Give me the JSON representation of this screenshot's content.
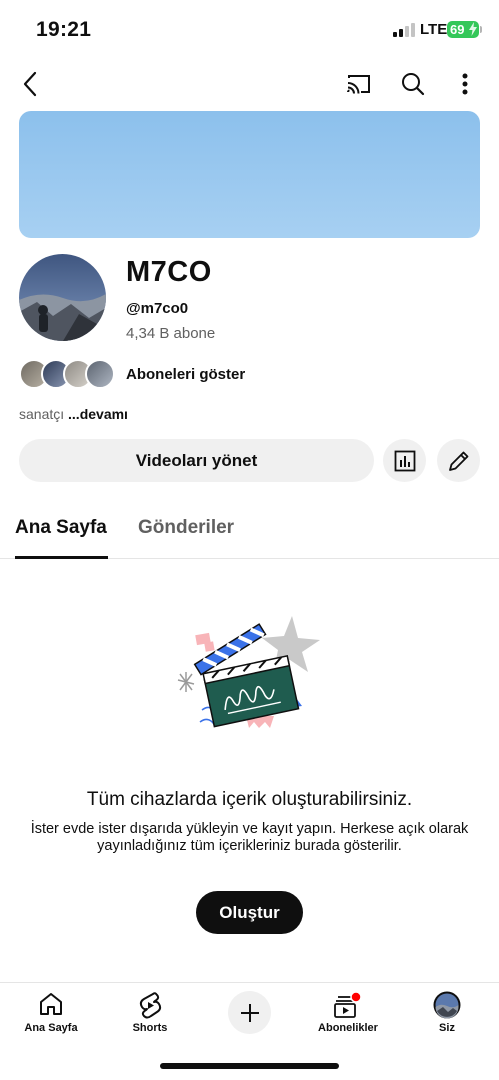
{
  "status_bar": {
    "time": "19:21",
    "network": "LTE",
    "battery": "69"
  },
  "top_bar": {
    "back_icon": "chevron-left-icon",
    "cast_icon": "cast-icon",
    "search_icon": "search-icon",
    "more_icon": "more-vertical-icon"
  },
  "channel": {
    "name": "M7CO",
    "handle": "@m7co0",
    "subscribers": "4,34 B abone",
    "show_subscribers": "Aboneleri göster",
    "about_text": "sanatçı",
    "about_more": "...devamı"
  },
  "actions": {
    "manage_videos": "Videoları yönet",
    "analytics_icon": "bar-chart-icon",
    "edit_icon": "pencil-icon"
  },
  "tabs": [
    {
      "label": "Ana Sayfa",
      "active": true
    },
    {
      "label": "Gönderiler",
      "active": false
    }
  ],
  "empty_state": {
    "title": "Tüm cihazlarda içerik oluşturabilirsiniz.",
    "description": "İster evde ister dışarıda yükleyin ve kayıt yapın. Herkese açık olarak yayınladığınız tüm içerikleriniz burada gösterilir.",
    "button": "Oluştur"
  },
  "bottom_nav": [
    {
      "label": "Ana Sayfa",
      "icon": "home-icon"
    },
    {
      "label": "Shorts",
      "icon": "shorts-icon"
    },
    {
      "label": "",
      "icon": "plus-icon"
    },
    {
      "label": "Abonelikler",
      "icon": "subscriptions-icon"
    },
    {
      "label": "Siz",
      "icon": "profile-avatar-icon"
    }
  ],
  "colors": {
    "banner": "#9ac8ef",
    "battery": "#34c759",
    "notification_dot": "#ff0000",
    "button_bg": "#f0f0f0"
  }
}
